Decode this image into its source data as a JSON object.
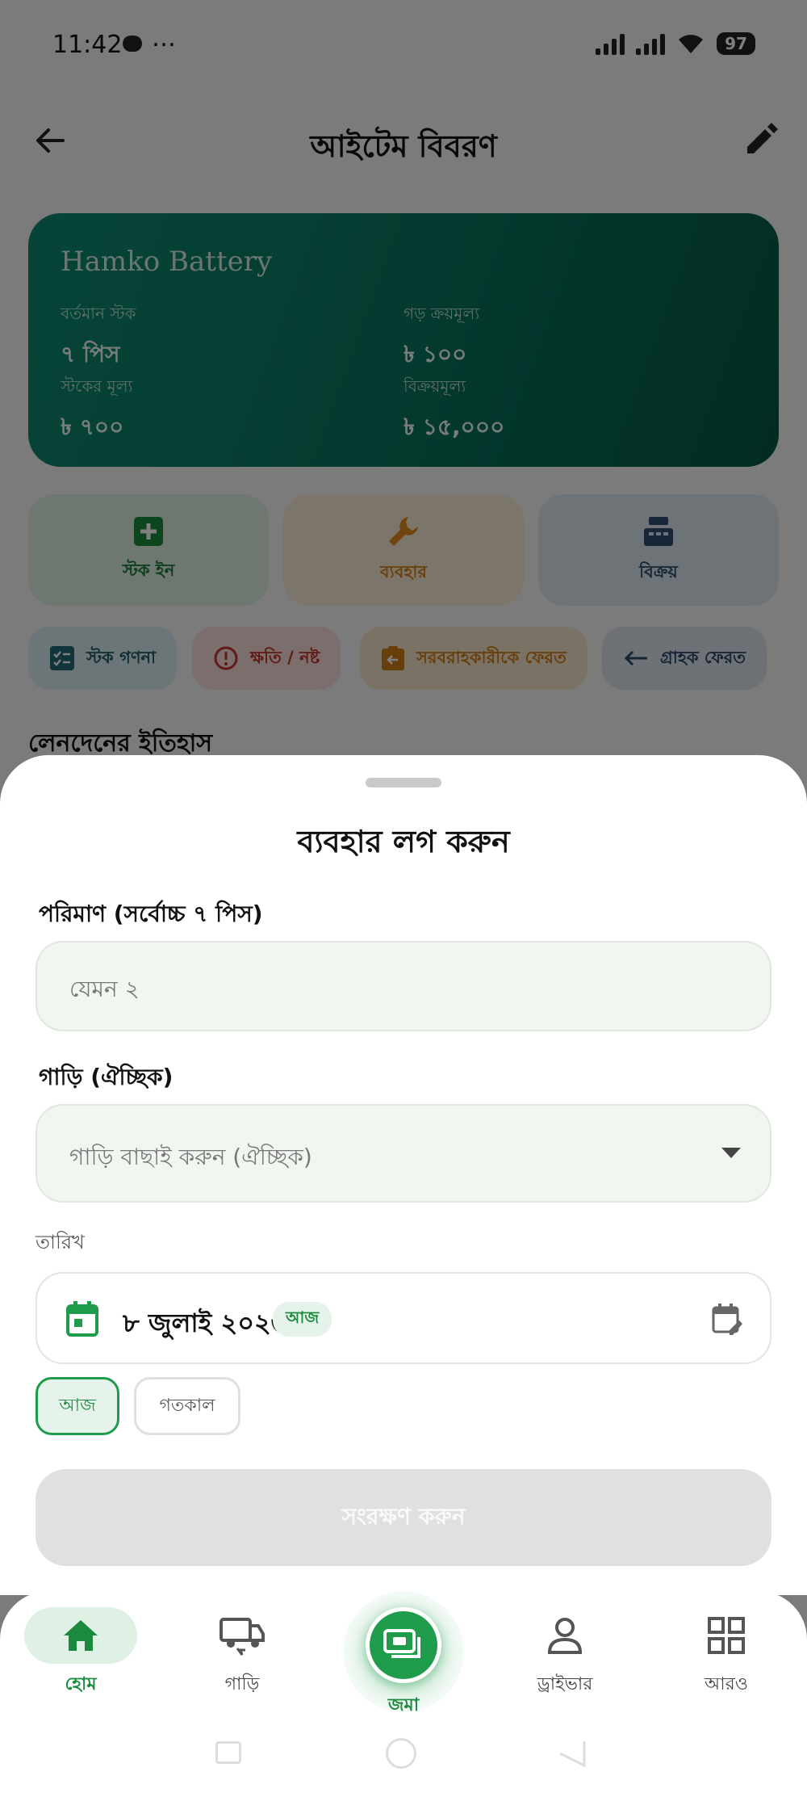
{
  "status_bar": {
    "time": "11:42",
    "extra": "…",
    "battery": "97"
  },
  "appbar": {
    "title": "আইটেম বিবরণ"
  },
  "item": {
    "name": "Hamko Battery",
    "current_stock_label": "বর্তমান স্টক",
    "current_stock_value": "৭ পিস",
    "avg_cost_label": "গড় ক্রয়মূল্য",
    "avg_cost_value": "৳ ১০০",
    "stock_value_label": "স্টকের মূল্য",
    "stock_value_value": "৳ ৭০০",
    "sale_price_label": "বিক্রয়মূল্য",
    "sale_price_value": "৳ ১৫,০০০"
  },
  "actions": {
    "stock_in": "স্টক ইন",
    "usage": "ব্যবহার",
    "sale": "বিক্রয়"
  },
  "chips": {
    "stock_count": "স্টক গণনা",
    "damage": "ক্ষতি / নষ্ট",
    "supplier_return": "সরবরাহকারীকে ফেরত",
    "customer_return": "গ্রাহক ফেরত"
  },
  "history_title": "লেনদেনের ইতিহাস",
  "sheet": {
    "title": "ব্যবহার লগ করুন",
    "quantity_label": "পরিমাণ (সর্বোচ্চ ৭ পিস)",
    "quantity_placeholder": "যেমন ২",
    "vehicle_label": "গাড়ি (ঐচ্ছিক)",
    "vehicle_placeholder": "গাড়ি বাছাই করুন (ঐচ্ছিক)",
    "date_label": "তারিখ",
    "date_value": "৮ জুলাই ২০২৬",
    "today_badge": "আজ",
    "quick_today": "আজ",
    "quick_yesterday": "গতকাল",
    "save": "সংরক্ষণ করুন"
  },
  "nav": {
    "home": "হোম",
    "vehicles": "গাড়ি",
    "deposit": "জমা",
    "driver": "ড্রাইভার",
    "more": "আরও"
  },
  "colors": {
    "accent": "#1f9b4c",
    "hero_start": "#0d8a72",
    "hero_end": "#055746",
    "usage_orange": "#e08a1e",
    "damage_red": "#d23a2e"
  }
}
